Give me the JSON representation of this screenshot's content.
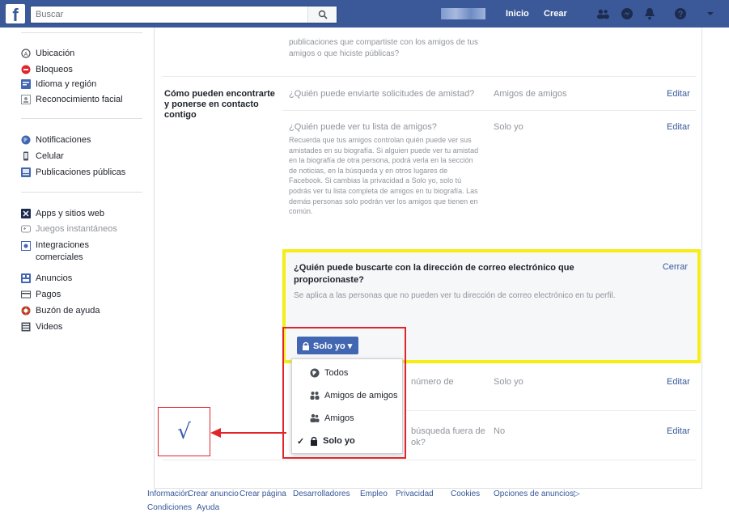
{
  "topbar": {
    "logo": "f",
    "search_placeholder": "Buscar",
    "nav": [
      "Inicio",
      "Crear"
    ]
  },
  "sidebar": {
    "items": [
      {
        "label": "Ubicación",
        "icon": "location-icon"
      },
      {
        "label": "Bloqueos",
        "icon": "block-icon"
      },
      {
        "label": "Idioma y región",
        "icon": "language-icon"
      },
      {
        "label": "Reconocimiento facial",
        "icon": "face-recognition-icon"
      },
      {
        "label": "Notificaciones",
        "icon": "globe-icon"
      },
      {
        "label": "Celular",
        "icon": "mobile-icon"
      },
      {
        "label": "Publicaciones públicas",
        "icon": "public-posts-icon"
      },
      {
        "label": "Apps y sitios web",
        "icon": "apps-icon"
      },
      {
        "label": "Juegos instantáneos",
        "icon": "games-icon"
      },
      {
        "label": "Integraciones comerciales",
        "icon": "integrations-icon"
      },
      {
        "label": "Anuncios",
        "icon": "ads-icon"
      },
      {
        "label": "Pagos",
        "icon": "payments-icon"
      },
      {
        "label": "Buzón de ayuda",
        "icon": "help-inbox-icon"
      },
      {
        "label": "Videos",
        "icon": "videos-icon"
      }
    ]
  },
  "content": {
    "top_desc": "publicaciones que compartiste con los amigos de tus amigos o que hiciste públicas?",
    "section_title": "Cómo pueden encontrarte y ponerse en contacto contigo",
    "rows": [
      {
        "question": "¿Quién puede enviarte solicitudes de amistad?",
        "value": "Amigos de amigos",
        "action": "Editar"
      },
      {
        "question": "¿Quién puede ver tu lista de amigos?",
        "value": "Solo yo",
        "action": "Editar",
        "desc": "Recuerda que tus amigos controlan quién puede ver sus amistades en su biografía. Si alguien puede ver tu amistad en la biografía de otra persona, podrá verla en la sección de noticias, en la búsqueda y en otros lugares de Facebook. Si cambias la privacidad a Solo yo, solo tú podrás ver tu lista completa de amigos en tu biografía. Las demás personas solo podrán ver los amigos que tienen en común."
      },
      {
        "question": "número de",
        "value": "Solo yo",
        "action": "Editar"
      },
      {
        "question": "búsqueda fuera de",
        "question2": "ok?",
        "value": "No",
        "action": "Editar"
      }
    ],
    "email_section": {
      "title": "¿Quién puede buscarte con la dirección de correo electrónico que proporcionaste?",
      "desc": "Se aplica a las personas que no pueden ver tu dirección de correo electrónico en tu perfil.",
      "close": "Cerrar",
      "button": "Solo yo ▾"
    },
    "dropdown": {
      "options": [
        "Todos",
        "Amigos de amigos",
        "Amigos",
        "Solo yo"
      ],
      "selected": "Solo yo"
    }
  },
  "annotation": {
    "check": "√"
  },
  "footer": {
    "links": [
      "Información",
      "Crear anuncio",
      "Crear página",
      "Desarrolladores",
      "Empleo",
      "Privacidad",
      "Cookies",
      "Opciones de anuncios▷",
      "Condiciones",
      "Ayuda"
    ]
  },
  "colors": {
    "brand": "#3b5998",
    "highlight": "#f5ed14",
    "annotation_red": "#e0262b"
  }
}
